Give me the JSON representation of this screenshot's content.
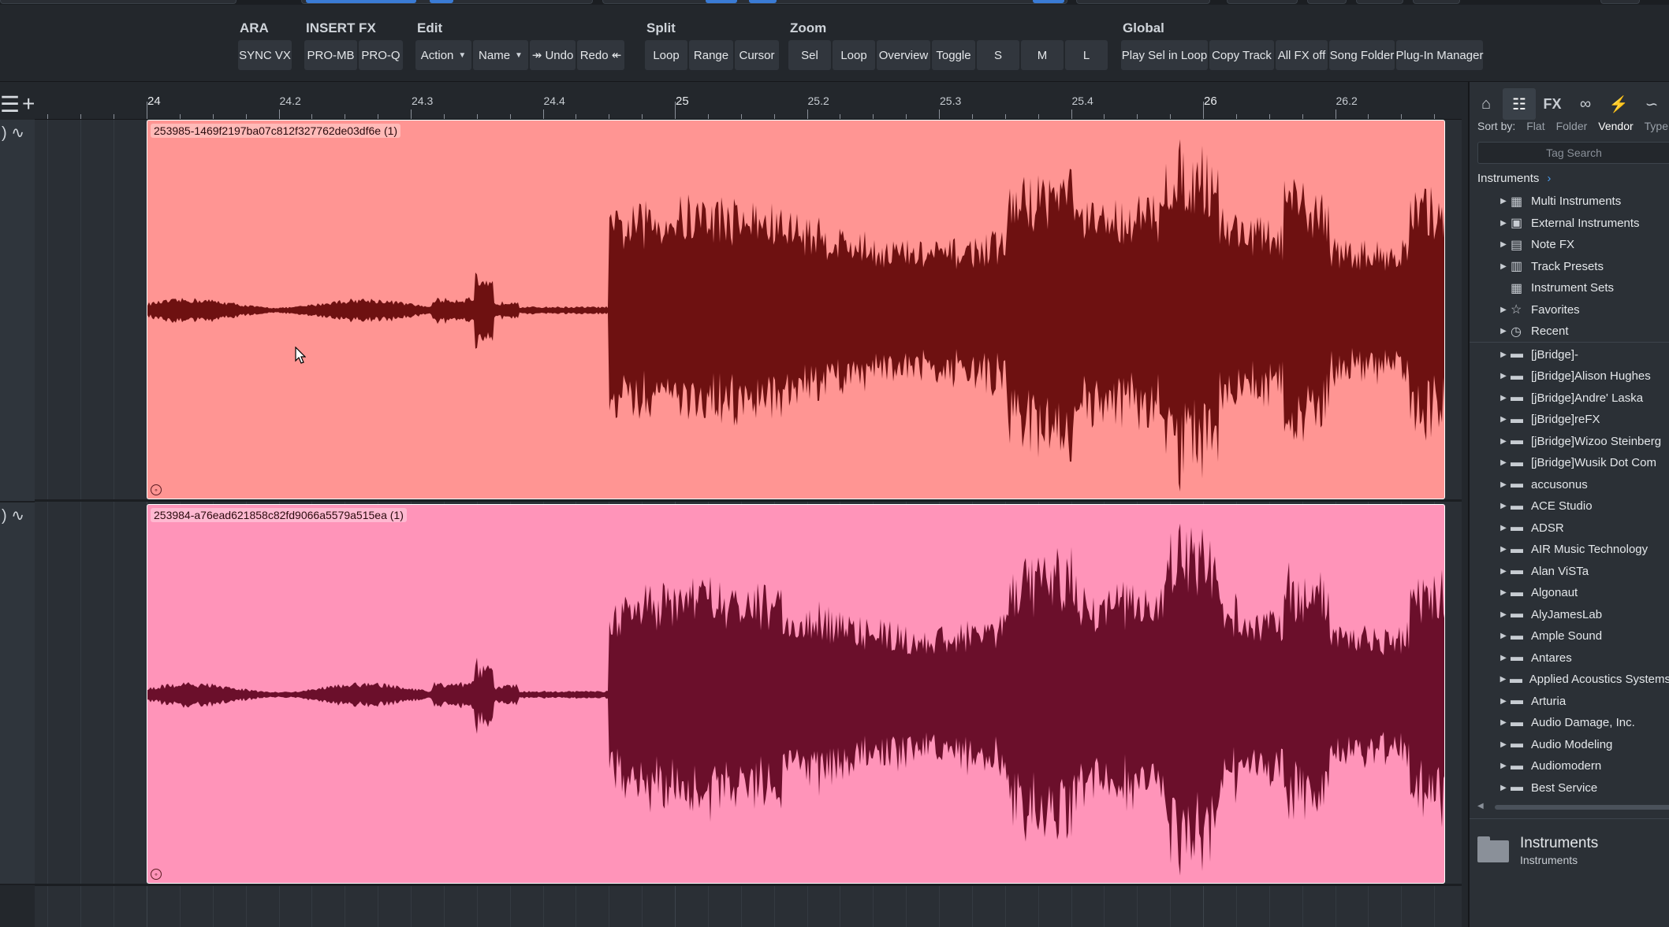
{
  "toolbar": {
    "groups": [
      {
        "title": "ARA",
        "buttons": [
          "SYNC VX"
        ]
      },
      {
        "title": "INSERT FX",
        "buttons": [
          "PRO-MB",
          "PRO-Q"
        ]
      },
      {
        "title": "Edit",
        "buttons": [
          "Action",
          "Name",
          "↠ Undo",
          "Redo ↞"
        ]
      },
      {
        "title": "Split",
        "buttons": [
          "Loop",
          "Range",
          "Cursor"
        ]
      },
      {
        "title": "Zoom",
        "buttons": [
          "Sel",
          "Loop",
          "Overview",
          "Toggle",
          "S",
          "M",
          "L"
        ]
      },
      {
        "title": "Global",
        "buttons": [
          "Play Sel in Loop",
          "Copy Track",
          "All FX off",
          "Song Folder",
          "Plug-In Manager"
        ]
      }
    ]
  },
  "ruler": {
    "labels": [
      "24",
      "24.2",
      "24.3",
      "24.4",
      "25",
      "25.2",
      "25.3",
      "25.4",
      "26",
      "26.2"
    ]
  },
  "clips": [
    {
      "name": "253985-1469f2197ba07c812f327762de03df6e (1)",
      "color": "#ff9593",
      "wave_color": "#6e1111"
    },
    {
      "name": "253984-a76ead621858c82fd9066a5579a515ea (1)",
      "color": "#ff94b9",
      "wave_color": "#6b0f2b"
    }
  ],
  "browser": {
    "tabs": [
      "home-icon",
      "instruments-icon",
      "fx-icon",
      "loops-icon",
      "files-icon",
      "cloud-icon"
    ],
    "fx_tab_label": "FX",
    "sort_label": "Sort by:",
    "sort_options": [
      "Flat",
      "Folder",
      "Vendor",
      "Type"
    ],
    "sort_active": "Vendor",
    "tag_search_placeholder": "Tag Search",
    "breadcrumb": "Instruments",
    "items": [
      {
        "label": "Multi Instruments",
        "icon": "multi-instrument-icon",
        "expandable": true
      },
      {
        "label": "External Instruments",
        "icon": "external-instrument-icon",
        "expandable": true
      },
      {
        "label": "Note FX",
        "icon": "note-fx-icon",
        "expandable": true
      },
      {
        "label": "Track Presets",
        "icon": "track-presets-icon",
        "expandable": true
      },
      {
        "label": "Instrument Sets",
        "icon": "instrument-sets-icon",
        "expandable": false
      },
      {
        "label": "Favorites",
        "icon": "star-icon",
        "expandable": true
      },
      {
        "label": "Recent",
        "icon": "clock-icon",
        "expandable": true
      },
      {
        "label": "[jBridge]-",
        "icon": "folder-icon",
        "expandable": true
      },
      {
        "label": "[jBridge]Alison Hughes",
        "icon": "folder-icon",
        "expandable": true
      },
      {
        "label": "[jBridge]Andre' Laska",
        "icon": "folder-icon",
        "expandable": true
      },
      {
        "label": "[jBridge]reFX",
        "icon": "folder-icon",
        "expandable": true
      },
      {
        "label": "[jBridge]Wizoo  Steinberg",
        "icon": "folder-icon",
        "expandable": true
      },
      {
        "label": "[jBridge]Wusik Dot Com",
        "icon": "folder-icon",
        "expandable": true
      },
      {
        "label": "accusonus",
        "icon": "folder-icon",
        "expandable": true
      },
      {
        "label": "ACE Studio",
        "icon": "folder-icon",
        "expandable": true
      },
      {
        "label": "ADSR",
        "icon": "folder-icon",
        "expandable": true
      },
      {
        "label": "AIR Music Technology",
        "icon": "folder-icon",
        "expandable": true
      },
      {
        "label": "Alan ViSTa",
        "icon": "folder-icon",
        "expandable": true
      },
      {
        "label": "Algonaut",
        "icon": "folder-icon",
        "expandable": true
      },
      {
        "label": "AlyJamesLab",
        "icon": "folder-icon",
        "expandable": true
      },
      {
        "label": "Ample Sound",
        "icon": "folder-icon",
        "expandable": true
      },
      {
        "label": "Antares",
        "icon": "folder-icon",
        "expandable": true
      },
      {
        "label": "Applied Acoustics Systems",
        "icon": "folder-icon",
        "expandable": true
      },
      {
        "label": "Arturia",
        "icon": "folder-icon",
        "expandable": true
      },
      {
        "label": "Audio Damage, Inc.",
        "icon": "folder-icon",
        "expandable": true
      },
      {
        "label": "Audio Modeling",
        "icon": "folder-icon",
        "expandable": true
      },
      {
        "label": "Audiomodern",
        "icon": "folder-icon",
        "expandable": true
      },
      {
        "label": "Best Service",
        "icon": "folder-icon",
        "expandable": true
      }
    ],
    "footer_title": "Instruments",
    "footer_subtitle": "Instruments"
  }
}
